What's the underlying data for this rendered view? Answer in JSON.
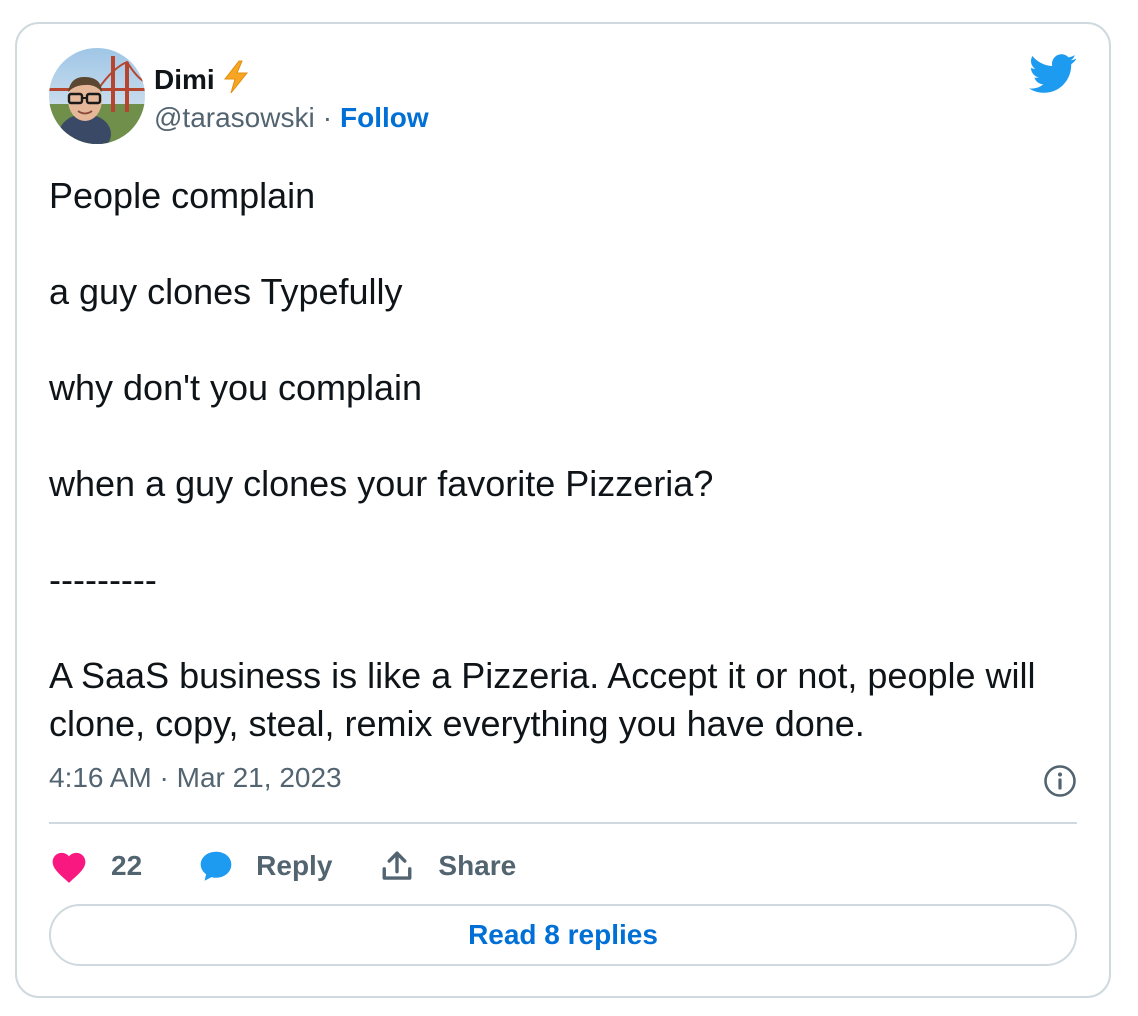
{
  "author": {
    "name": "Dimi",
    "name_emoji": "lightning-bolt-icon",
    "handle": "@tarasowski",
    "separator": "·",
    "follow_label": "Follow"
  },
  "tweet": {
    "text": "People complain\n\na guy clones Typefully\n\nwhy don't you complain\n\nwhen a guy clones your favorite Pizzeria?\n\n---------\n\nA SaaS business is like a Pizzeria. Accept it or not, people will clone, copy, steal, remix everything you have done.",
    "timestamp": "4:16 AM · Mar 21, 2023"
  },
  "actions": {
    "like_count": "22",
    "reply_label": "Reply",
    "share_label": "Share"
  },
  "read_replies_label": "Read 8 replies",
  "icons": {
    "logo": "twitter-bird-icon",
    "info": "info-icon",
    "like": "heart-icon",
    "reply": "speech-bubble-icon",
    "share": "share-upload-icon"
  },
  "colors": {
    "brand": "#1d9bf0",
    "link": "#006fd6",
    "like": "#f91880",
    "secondary_text": "#536471",
    "border": "#cfd9de"
  }
}
